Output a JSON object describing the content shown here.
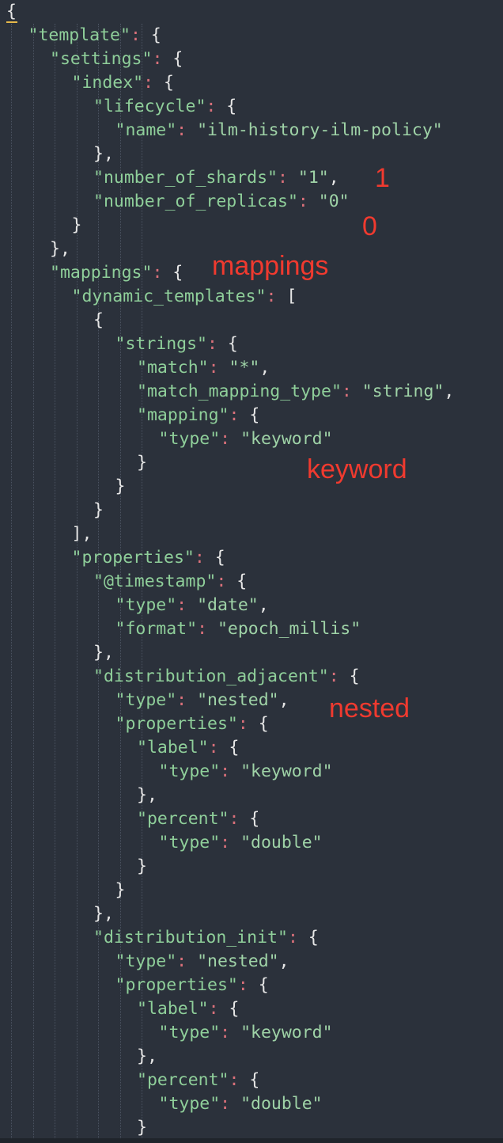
{
  "editor": {
    "colors": {
      "background": "#2b313b",
      "key": "#8fcf9a",
      "string": "#9fd3a7",
      "colon": "#d9707a",
      "punctuation": "#e6e6e6",
      "annotation": "#f03a2f",
      "cursor": "#e6b84a"
    },
    "lines": [
      [
        {
          "t": "{",
          "c": "p"
        }
      ],
      [
        {
          "t": "\"template\"",
          "c": "k"
        },
        {
          "t": ": ",
          "c": "c"
        },
        {
          "t": "{",
          "c": "p"
        }
      ],
      [
        {
          "t": "\"settings\"",
          "c": "k"
        },
        {
          "t": ": ",
          "c": "c"
        },
        {
          "t": "{",
          "c": "p"
        }
      ],
      [
        {
          "t": "\"index\"",
          "c": "k"
        },
        {
          "t": ": ",
          "c": "c"
        },
        {
          "t": "{",
          "c": "p"
        }
      ],
      [
        {
          "t": "\"lifecycle\"",
          "c": "k"
        },
        {
          "t": ": ",
          "c": "c"
        },
        {
          "t": "{",
          "c": "p"
        }
      ],
      [
        {
          "t": "\"name\"",
          "c": "k"
        },
        {
          "t": ": ",
          "c": "c"
        },
        {
          "t": "\"ilm-history-ilm-policy\"",
          "c": "s"
        }
      ],
      [
        {
          "t": "},",
          "c": "p"
        }
      ],
      [
        {
          "t": "\"number_of_shards\"",
          "c": "k"
        },
        {
          "t": ": ",
          "c": "c"
        },
        {
          "t": "\"1\"",
          "c": "s"
        },
        {
          "t": ",",
          "c": "p"
        }
      ],
      [
        {
          "t": "\"number_of_replicas\"",
          "c": "k"
        },
        {
          "t": ": ",
          "c": "c"
        },
        {
          "t": "\"0\"",
          "c": "s"
        }
      ],
      [
        {
          "t": "}",
          "c": "p"
        }
      ],
      [
        {
          "t": "},",
          "c": "p"
        }
      ],
      [
        {
          "t": "\"mappings\"",
          "c": "k"
        },
        {
          "t": ": ",
          "c": "c"
        },
        {
          "t": "{",
          "c": "p"
        }
      ],
      [
        {
          "t": "\"dynamic_templates\"",
          "c": "k"
        },
        {
          "t": ": ",
          "c": "c"
        },
        {
          "t": "[",
          "c": "p"
        }
      ],
      [
        {
          "t": "{",
          "c": "p"
        }
      ],
      [
        {
          "t": "\"strings\"",
          "c": "k"
        },
        {
          "t": ": ",
          "c": "c"
        },
        {
          "t": "{",
          "c": "p"
        }
      ],
      [
        {
          "t": "\"match\"",
          "c": "k"
        },
        {
          "t": ": ",
          "c": "c"
        },
        {
          "t": "\"*\"",
          "c": "s"
        },
        {
          "t": ",",
          "c": "p"
        }
      ],
      [
        {
          "t": "\"match_mapping_type\"",
          "c": "k"
        },
        {
          "t": ": ",
          "c": "c"
        },
        {
          "t": "\"string\"",
          "c": "s"
        },
        {
          "t": ",",
          "c": "p"
        }
      ],
      [
        {
          "t": "\"mapping\"",
          "c": "k"
        },
        {
          "t": ": ",
          "c": "c"
        },
        {
          "t": "{",
          "c": "p"
        }
      ],
      [
        {
          "t": "\"type\"",
          "c": "k"
        },
        {
          "t": ": ",
          "c": "c"
        },
        {
          "t": "\"keyword\"",
          "c": "s"
        }
      ],
      [
        {
          "t": "}",
          "c": "p"
        }
      ],
      [
        {
          "t": "}",
          "c": "p"
        }
      ],
      [
        {
          "t": "}",
          "c": "p"
        }
      ],
      [
        {
          "t": "],",
          "c": "p"
        }
      ],
      [
        {
          "t": "\"properties\"",
          "c": "k"
        },
        {
          "t": ": ",
          "c": "c"
        },
        {
          "t": "{",
          "c": "p"
        }
      ],
      [
        {
          "t": "\"@timestamp\"",
          "c": "k"
        },
        {
          "t": ": ",
          "c": "c"
        },
        {
          "t": "{",
          "c": "p"
        }
      ],
      [
        {
          "t": "\"type\"",
          "c": "k"
        },
        {
          "t": ": ",
          "c": "c"
        },
        {
          "t": "\"date\"",
          "c": "s"
        },
        {
          "t": ",",
          "c": "p"
        }
      ],
      [
        {
          "t": "\"format\"",
          "c": "k"
        },
        {
          "t": ": ",
          "c": "c"
        },
        {
          "t": "\"epoch_millis\"",
          "c": "s"
        }
      ],
      [
        {
          "t": "},",
          "c": "p"
        }
      ],
      [
        {
          "t": "\"distribution_adjacent\"",
          "c": "k"
        },
        {
          "t": ": ",
          "c": "c"
        },
        {
          "t": "{",
          "c": "p"
        }
      ],
      [
        {
          "t": "\"type\"",
          "c": "k"
        },
        {
          "t": ": ",
          "c": "c"
        },
        {
          "t": "\"nested\"",
          "c": "s"
        },
        {
          "t": ",",
          "c": "p"
        }
      ],
      [
        {
          "t": "\"properties\"",
          "c": "k"
        },
        {
          "t": ": ",
          "c": "c"
        },
        {
          "t": "{",
          "c": "p"
        }
      ],
      [
        {
          "t": "\"label\"",
          "c": "k"
        },
        {
          "t": ": ",
          "c": "c"
        },
        {
          "t": "{",
          "c": "p"
        }
      ],
      [
        {
          "t": "\"type\"",
          "c": "k"
        },
        {
          "t": ": ",
          "c": "c"
        },
        {
          "t": "\"keyword\"",
          "c": "s"
        }
      ],
      [
        {
          "t": "},",
          "c": "p"
        }
      ],
      [
        {
          "t": "\"percent\"",
          "c": "k"
        },
        {
          "t": ": ",
          "c": "c"
        },
        {
          "t": "{",
          "c": "p"
        }
      ],
      [
        {
          "t": "\"type\"",
          "c": "k"
        },
        {
          "t": ": ",
          "c": "c"
        },
        {
          "t": "\"double\"",
          "c": "s"
        }
      ],
      [
        {
          "t": "}",
          "c": "p"
        }
      ],
      [
        {
          "t": "}",
          "c": "p"
        }
      ],
      [
        {
          "t": "},",
          "c": "p"
        }
      ],
      [
        {
          "t": "\"distribution_init\"",
          "c": "k"
        },
        {
          "t": ": ",
          "c": "c"
        },
        {
          "t": "{",
          "c": "p"
        }
      ],
      [
        {
          "t": "\"type\"",
          "c": "k"
        },
        {
          "t": ": ",
          "c": "c"
        },
        {
          "t": "\"nested\"",
          "c": "s"
        },
        {
          "t": ",",
          "c": "p"
        }
      ],
      [
        {
          "t": "\"properties\"",
          "c": "k"
        },
        {
          "t": ": ",
          "c": "c"
        },
        {
          "t": "{",
          "c": "p"
        }
      ],
      [
        {
          "t": "\"label\"",
          "c": "k"
        },
        {
          "t": ": ",
          "c": "c"
        },
        {
          "t": "{",
          "c": "p"
        }
      ],
      [
        {
          "t": "\"type\"",
          "c": "k"
        },
        {
          "t": ": ",
          "c": "c"
        },
        {
          "t": "\"keyword\"",
          "c": "s"
        }
      ],
      [
        {
          "t": "},",
          "c": "p"
        }
      ],
      [
        {
          "t": "\"percent\"",
          "c": "k"
        },
        {
          "t": ": ",
          "c": "c"
        },
        {
          "t": "{",
          "c": "p"
        }
      ],
      [
        {
          "t": "\"type\"",
          "c": "k"
        },
        {
          "t": ": ",
          "c": "c"
        },
        {
          "t": "\"double\"",
          "c": "s"
        }
      ],
      [
        {
          "t": "}",
          "c": "p"
        }
      ]
    ]
  },
  "annotations": {
    "shards": "1",
    "replicas": "0",
    "mappings": "mappings",
    "keyword": "keyword",
    "nested": "nested"
  }
}
